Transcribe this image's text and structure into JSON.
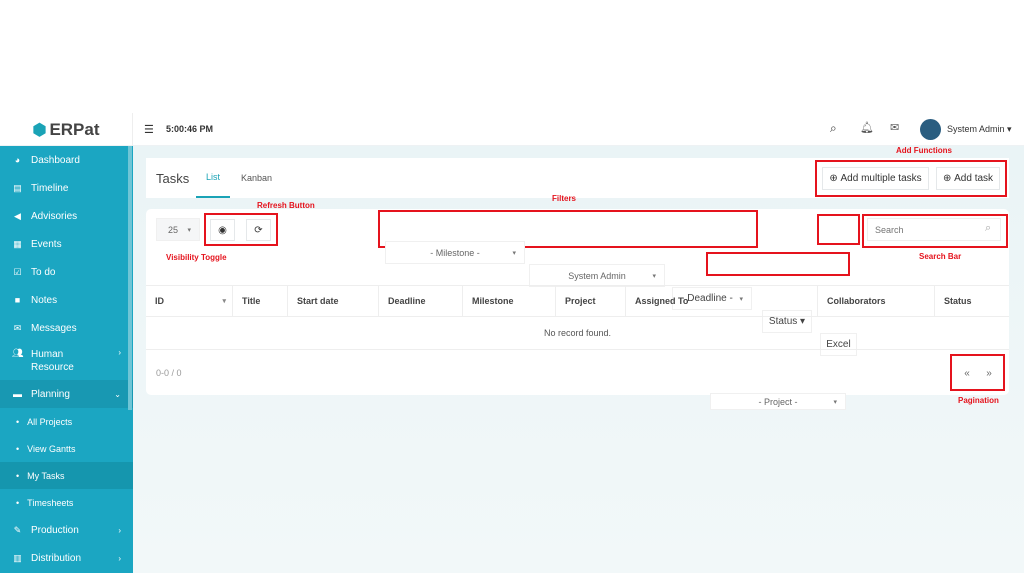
{
  "header": {
    "logo": "ERPat",
    "time": "5:00:46 PM",
    "user": "System Admin"
  },
  "sidebar": {
    "items": [
      {
        "label": "Dashboard",
        "icon": "dashboard-icon",
        "glyph": "◕"
      },
      {
        "label": "Timeline",
        "icon": "timeline-icon",
        "glyph": "▤"
      },
      {
        "label": "Advisories",
        "icon": "megaphone-icon",
        "glyph": "◀"
      },
      {
        "label": "Events",
        "icon": "calendar-icon",
        "glyph": "▦"
      },
      {
        "label": "To do",
        "icon": "checkbox-icon",
        "glyph": "☑"
      },
      {
        "label": "Notes",
        "icon": "note-icon",
        "glyph": "■"
      },
      {
        "label": "Messages",
        "icon": "envelope-icon",
        "glyph": "✉"
      }
    ],
    "human_resource": "Human Resource",
    "planning": "Planning",
    "sub": [
      "All Projects",
      "View Gantts",
      "My Tasks",
      "Timesheets"
    ],
    "production": "Production",
    "distribution": "Distribution"
  },
  "page": {
    "title": "Tasks",
    "tabs": [
      "List",
      "Kanban"
    ],
    "add_multiple": "Add multiple tasks",
    "add_task": "Add task"
  },
  "toolbar": {
    "page_size": "25",
    "milestone": "- Milestone -",
    "assignee": "System Admin",
    "deadline": "- Deadline -",
    "status": "Status",
    "excel": "Excel",
    "search_placeholder": "Search",
    "project": "- Project -"
  },
  "table": {
    "columns": [
      "ID",
      "Title",
      "Start date",
      "Deadline",
      "Milestone",
      "Project",
      "Assigned To",
      "Collaborators",
      "Status"
    ],
    "empty": "No record found.",
    "range": "0-0 / 0",
    "prev": "«",
    "next": "»"
  },
  "annotations": {
    "add_functions": "Add Functions",
    "refresh": "Refresh Button",
    "filters": "Filters",
    "visibility": "Visibility Toggle",
    "search": "Search Bar",
    "pagination": "Pagination"
  }
}
